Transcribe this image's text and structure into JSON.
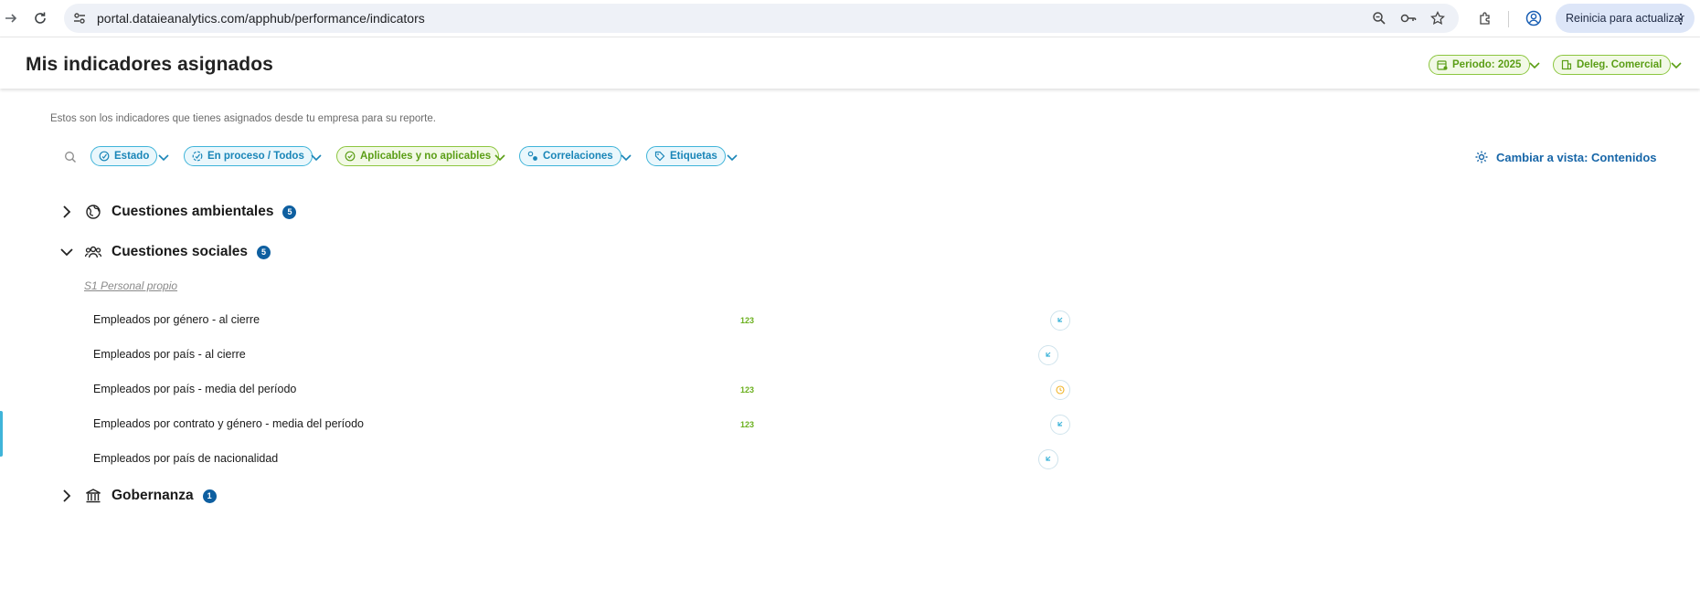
{
  "browser": {
    "url": "portal.dataieanalytics.com/apphub/performance/indicators",
    "update_label": "Reinicia para actualizar"
  },
  "header": {
    "title": "Mis indicadores asignados",
    "period_label": "Periodo: 2025",
    "delegation_label": "Deleg. Comercial"
  },
  "intro_text": "Estos son los indicadores que tienes asignados desde tu empresa para su reporte.",
  "filters": [
    {
      "label": "Estado"
    },
    {
      "label": "En proceso / Todos"
    },
    {
      "label": "Aplicables y no aplicables"
    },
    {
      "label": "Correlaciones"
    },
    {
      "label": "Etiquetas"
    }
  ],
  "view_switch_label": "Cambiar a vista: Contenidos",
  "sections": [
    {
      "title": "Cuestiones ambientales",
      "count": "5",
      "expanded": false
    },
    {
      "title": "Cuestiones sociales",
      "count": "5",
      "expanded": true
    },
    {
      "title": "Gobernanza",
      "count": "1",
      "expanded": false
    }
  ],
  "subgroup_label": "S1 Personal propio",
  "indicators": [
    {
      "label": "Empleados por género - al cierre",
      "tag": "123"
    },
    {
      "label": "Empleados por país - al cierre",
      "tag": ""
    },
    {
      "label": "Empleados por país - media del período",
      "tag": "123"
    },
    {
      "label": "Empleados por contrato y género - media del período",
      "tag": "123"
    },
    {
      "label": "Empleados por país de nacionalidad",
      "tag": ""
    }
  ],
  "colors": {
    "accent_blue": "#1766a8",
    "pill_blue": "#3fb4d9",
    "pill_green": "#8cc63f",
    "badge": "#0e5fa0",
    "status_pending": "#f0b429"
  }
}
